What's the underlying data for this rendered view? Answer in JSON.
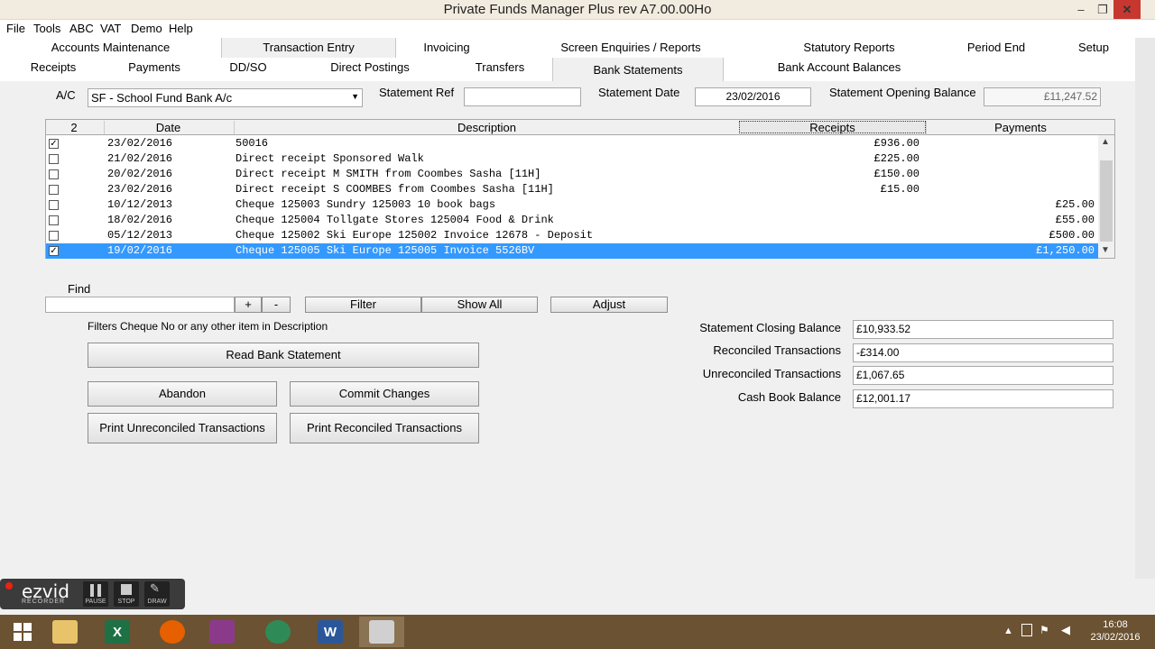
{
  "window": {
    "title": "Private Funds Manager Plus rev A7.00.00Ho",
    "minimize": "–",
    "maximize": "❐",
    "close": "✕"
  },
  "menu": [
    "File",
    "Tools",
    "ABC",
    "VAT",
    "Demo",
    "Help"
  ],
  "tabs_main": [
    "Accounts Maintenance",
    "Transaction Entry",
    "Invoicing",
    "Screen Enquiries / Reports",
    "Statutory Reports",
    "Period End",
    "Setup"
  ],
  "tabs_sub": [
    "Receipts",
    "Payments",
    "DD/SO",
    "Direct Postings",
    "Transfers",
    "Bank Statements",
    "Bank Account Balances"
  ],
  "form": {
    "ac_label": "A/C",
    "ac_value": "SF - School Fund Bank A/c",
    "statement_ref_label": "Statement Ref",
    "statement_ref_value": "",
    "statement_date_label": "Statement Date",
    "statement_date_value": "23/02/2016",
    "opening_balance_label": "Statement Opening Balance",
    "opening_balance_value": "£11,247.52"
  },
  "grid": {
    "count": "2",
    "headers": {
      "date": "Date",
      "description": "Description",
      "receipts": "Receipts",
      "payments": "Payments"
    },
    "rows": [
      {
        "checked": true,
        "date": "23/02/2016",
        "description": "50016",
        "receipts": "£936.00",
        "payments": ""
      },
      {
        "checked": false,
        "date": "21/02/2016",
        "description": "Direct receipt Sponsored Walk",
        "receipts": "£225.00",
        "payments": ""
      },
      {
        "checked": false,
        "date": "20/02/2016",
        "description": "Direct receipt M SMITH from Coombes Sasha [11H]",
        "receipts": "£150.00",
        "payments": ""
      },
      {
        "checked": false,
        "date": "23/02/2016",
        "description": "Direct receipt S COOMBES from Coombes Sasha [11H]",
        "receipts": "£15.00",
        "payments": ""
      },
      {
        "checked": false,
        "date": "10/12/2013",
        "description": "Cheque 125003 Sundry 125003 10 book bags",
        "receipts": "",
        "payments": "£25.00"
      },
      {
        "checked": false,
        "date": "18/02/2016",
        "description": "Cheque 125004 Tollgate Stores 125004 Food & Drink",
        "receipts": "",
        "payments": "£55.00"
      },
      {
        "checked": false,
        "date": "05/12/2013",
        "description": "Cheque 125002 Ski Europe 125002 Invoice 12678 - Deposit",
        "receipts": "",
        "payments": "£500.00"
      },
      {
        "checked": true,
        "date": "19/02/2016",
        "description": "Cheque 125005 Ski Europe 125005 Invoice 5526BV",
        "receipts": "",
        "payments": "£1,250.00",
        "selected": true
      }
    ]
  },
  "find": {
    "label": "Find",
    "value": "",
    "plus": "+",
    "minus": "-",
    "filter": "Filter",
    "show_all": "Show All",
    "adjust": "Adjust",
    "hint": "Filters Cheque No or any other item in Description"
  },
  "actions": {
    "read_statement": "Read Bank Statement",
    "abandon": "Abandon",
    "commit": "Commit Changes",
    "print_unreconciled": "Print Unreconciled Transactions",
    "print_reconciled": "Print Reconciled Transactions"
  },
  "balances": {
    "closing_label": "Statement Closing Balance",
    "closing_value": "£10,933.52",
    "reconciled_label": "Reconciled Transactions",
    "reconciled_value": "-£314.00",
    "unreconciled_label": "Unreconciled Transactions",
    "unreconciled_value": "£1,067.65",
    "cashbook_label": "Cash Book Balance",
    "cashbook_value": "£12,001.17"
  },
  "ezvid": {
    "brand": "ezvid",
    "sub": "RECORDER",
    "pause": "PAUSE",
    "stop": "STOP",
    "draw": "DRAW"
  },
  "taskbar": {
    "time": "16:08",
    "date": "23/02/2016"
  }
}
